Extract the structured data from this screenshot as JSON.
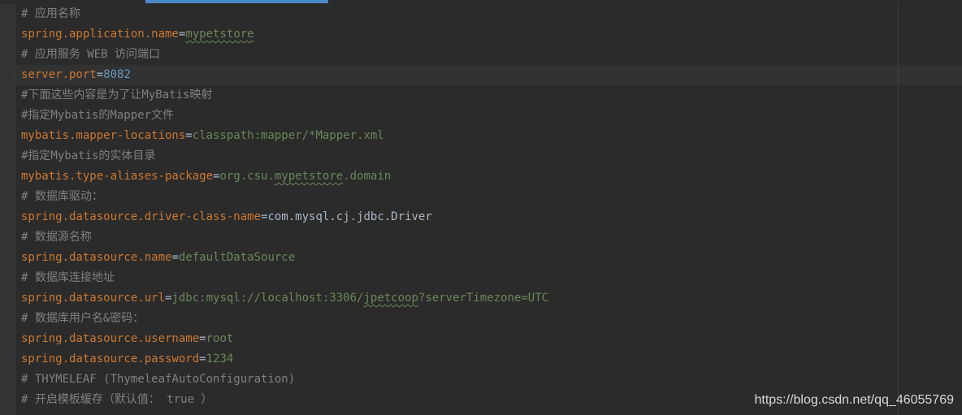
{
  "editor": {
    "lines": [
      {
        "type": "comment",
        "text": "# 应用名称"
      },
      {
        "type": "prop",
        "key": "spring.application.name",
        "sep": "=",
        "value_parts": [
          {
            "text": "mypetstore",
            "squiggle": true
          }
        ]
      },
      {
        "type": "comment",
        "text": "# 应用服务 WEB 访问端口"
      },
      {
        "type": "prop",
        "key": "server.port",
        "sep": "=",
        "value_parts": [
          {
            "text": "8082",
            "num": true
          }
        ]
      },
      {
        "type": "comment",
        "text": "#下面这些内容是为了让MyBatis映射"
      },
      {
        "type": "comment",
        "text": "#指定Mybatis的Mapper文件"
      },
      {
        "type": "prop",
        "key": "mybatis.mapper-locations",
        "sep": "=",
        "value_parts": [
          {
            "text": "classpath:mapper/*Mapper.xml"
          }
        ]
      },
      {
        "type": "comment",
        "text": "#指定Mybatis的实体目录"
      },
      {
        "type": "prop",
        "key": "mybatis.type-aliases-package",
        "sep": "=",
        "value_parts": [
          {
            "text": "org.csu."
          },
          {
            "text": "mypetstore",
            "squiggle": true
          },
          {
            "text": ".domain"
          }
        ]
      },
      {
        "type": "comment",
        "text": "# 数据库驱动："
      },
      {
        "type": "prop",
        "key": "spring.datasource.driver-class-name",
        "sep": "=",
        "value_parts": [
          {
            "text": "com.mysql.cj.jdbc.Driver",
            "plain": true
          }
        ]
      },
      {
        "type": "comment",
        "text": "# 数据源名称"
      },
      {
        "type": "prop",
        "key": "spring.datasource.name",
        "sep": "=",
        "value_parts": [
          {
            "text": "defaultDataSource"
          }
        ]
      },
      {
        "type": "comment",
        "text": "# 数据库连接地址"
      },
      {
        "type": "prop",
        "key": "spring.datasource.url",
        "sep": "=",
        "value_parts": [
          {
            "text": "jdbc:mysql://localhost:3306/"
          },
          {
            "text": "jpetcoop",
            "squiggle": true
          },
          {
            "text": "?serverTimezone=UTC"
          }
        ]
      },
      {
        "type": "comment",
        "text": "# 数据库用户名&密码："
      },
      {
        "type": "prop",
        "key": "spring.datasource.username",
        "sep": "=",
        "value_parts": [
          {
            "text": "root"
          }
        ]
      },
      {
        "type": "prop",
        "key": "spring.datasource.password",
        "sep": "=",
        "value_parts": [
          {
            "text": "1234"
          }
        ]
      },
      {
        "type": "comment",
        "text": "# THYMELEAF (ThymeleafAutoConfiguration)"
      },
      {
        "type": "comment",
        "text": "# 开启模板缓存（默认值： true ）"
      }
    ],
    "current_line_index": 3
  },
  "watermark": {
    "text": "https://blog.csdn.net/qq_46055769"
  },
  "colors": {
    "background": "#2b2b2b",
    "comment": "#808080",
    "key": "#cc7832",
    "value": "#6a8759",
    "number": "#6897bb",
    "plain": "#a9b7c6",
    "tab_indicator": "#4a88c7"
  }
}
